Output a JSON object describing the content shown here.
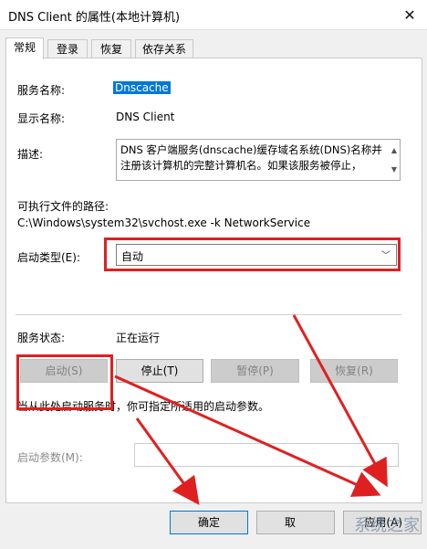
{
  "window": {
    "title": "DNS Client 的属性(本地计算机)",
    "close_glyph": "✕"
  },
  "tabs": [
    {
      "label": "常规",
      "active": true
    },
    {
      "label": "登录",
      "active": false
    },
    {
      "label": "恢复",
      "active": false
    },
    {
      "label": "依存关系",
      "active": false
    }
  ],
  "general": {
    "service_name_label": "服务名称:",
    "service_name_value": "Dnscache",
    "display_name_label": "显示名称:",
    "display_name_value": "DNS Client",
    "description_label": "描述:",
    "description_text": "DNS 客户端服务(dnscache)缓存域名系统(DNS)名称并注册该计算机的完整计算机名。如果该服务被停止，",
    "exe_path_label": "可执行文件的路径:",
    "exe_path_value": "C:\\Windows\\system32\\svchost.exe -k NetworkService",
    "startup_type_label": "启动类型(E):",
    "startup_type_value": "自动",
    "service_status_label": "服务状态:",
    "service_status_value": "正在运行",
    "start_button": "启动(S)",
    "stop_button": "停止(T)",
    "pause_button": "暂停(P)",
    "resume_button": "恢复(R)",
    "hint_text": "当从此处启动服务时，你可指定所适用的启动参数。",
    "start_params_label": "启动参数(M):",
    "start_params_value": ""
  },
  "footer": {
    "ok_button": "确定",
    "cancel_button_partial": "取",
    "apply_button_partial": "应用(A)"
  },
  "watermark_text": "系统之家",
  "annotation_color": "#e02020"
}
